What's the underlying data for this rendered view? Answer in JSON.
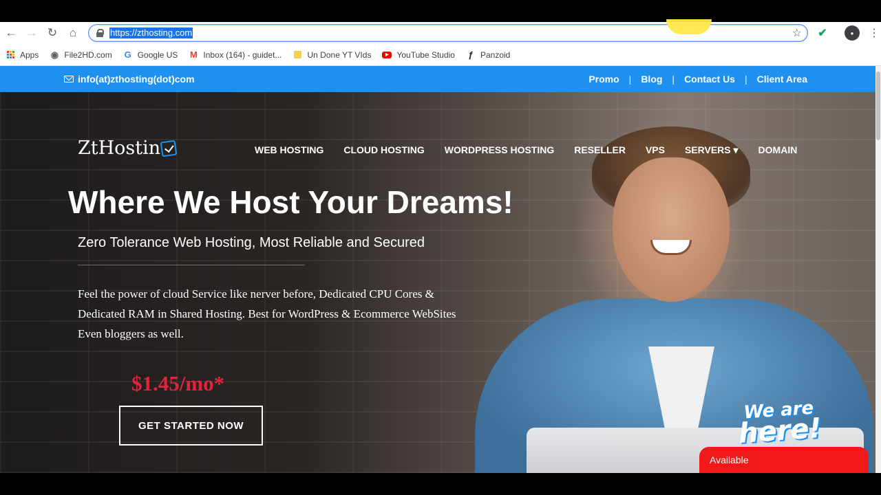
{
  "browser": {
    "url": "https://zthosting.com",
    "bookmarks": [
      {
        "label": "Apps",
        "icon": "apps-grid-icon"
      },
      {
        "label": "File2HD.com",
        "icon": "globe-icon"
      },
      {
        "label": "Google US",
        "icon": "google-icon"
      },
      {
        "label": "Inbox (164) - guidet...",
        "icon": "gmail-icon"
      },
      {
        "label": "Un Done YT VIds",
        "icon": "folder-icon"
      },
      {
        "label": "YouTube Studio",
        "icon": "youtube-icon"
      },
      {
        "label": "Panzoid",
        "icon": "panzoid-icon"
      }
    ]
  },
  "topbar": {
    "email": "info(at)zthosting(dot)com",
    "links": [
      "Promo",
      "Blog",
      "Contact Us",
      "Client Area"
    ],
    "color": "#1e90f0"
  },
  "logo": {
    "text": "ZtHostin"
  },
  "nav": {
    "items": [
      "WEB HOSTING",
      "CLOUD HOSTING",
      "WORDPRESS HOSTING",
      "RESELLER",
      "VPS",
      "SERVERS ▾",
      "DOMAIN"
    ]
  },
  "hero": {
    "headline": "Where We Host Your Dreams!",
    "subheadline": "Zero Tolerance Web Hosting, Most Reliable and Secured",
    "description": "Feel the power of cloud Service like nerver before, Dedicated CPU Cores & Dedicated RAM in Shared Hosting. Best for WordPress & Ecommerce WebSites Even bloggers as well.",
    "price": "$1.45/mo*",
    "cta_label": "GET STARTED NOW",
    "price_color": "#e0243a"
  },
  "chat": {
    "badge_line1": "We are",
    "badge_line2": "here!",
    "status": "Available",
    "color": "#f01818"
  }
}
